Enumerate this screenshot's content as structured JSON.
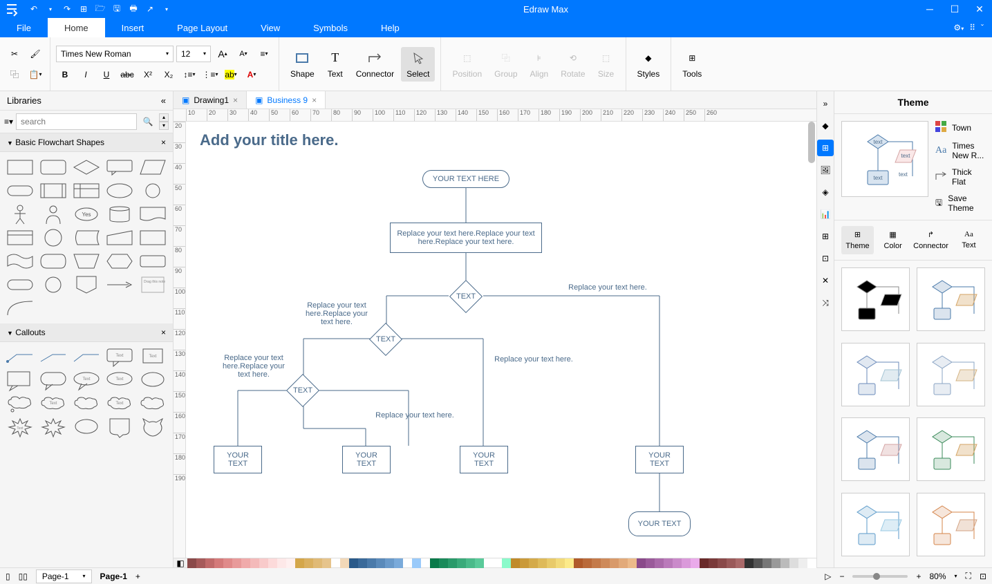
{
  "app": {
    "title": "Edraw Max"
  },
  "menu": {
    "tabs": [
      "File",
      "Home",
      "Insert",
      "Page Layout",
      "View",
      "Symbols",
      "Help"
    ],
    "active": 1
  },
  "ribbon": {
    "font_name": "Times New Roman",
    "font_size": "12",
    "big_buttons": [
      "Shape",
      "Text",
      "Connector",
      "Select"
    ],
    "big_active": 3,
    "arrange": [
      "Position",
      "Group",
      "Align",
      "Rotate",
      "Size"
    ],
    "right": [
      "Styles",
      "Tools"
    ]
  },
  "left": {
    "title": "Libraries",
    "search_placeholder": "search",
    "sections": [
      "Basic Flowchart Shapes",
      "Callouts"
    ]
  },
  "doc_tabs": [
    {
      "label": "Drawing1",
      "active": false
    },
    {
      "label": "Business 9",
      "active": true
    }
  ],
  "ruler_h": [
    "10",
    "20",
    "30",
    "40",
    "50",
    "60",
    "70",
    "80",
    "90",
    "100",
    "110",
    "120",
    "130",
    "140",
    "150",
    "160",
    "170",
    "180",
    "190",
    "200",
    "210",
    "220",
    "230",
    "240",
    "250",
    "260"
  ],
  "ruler_v": [
    "20",
    "30",
    "40",
    "50",
    "60",
    "70",
    "80",
    "90",
    "100",
    "110",
    "120",
    "130",
    "140",
    "150",
    "160",
    "170",
    "180",
    "190"
  ],
  "canvas": {
    "title": "Add your title here.",
    "start": "YOUR TEXT HERE",
    "process1": "Replace your text here.Replace your text here.Replace your text here.",
    "decision1": "TEXT",
    "decision2": "TEXT",
    "decision3": "TEXT",
    "label_right": "Replace your text here.",
    "label_left1": "Replace your text here.Replace your text here.",
    "label_left2": "Replace your text here.Replace your text here.",
    "label_mid1": "Replace your text here.",
    "label_mid2": "Replace your text here.",
    "box1": "YOUR TEXT",
    "box2": "YOUR TEXT",
    "box3": "YOUR TEXT",
    "box4": "YOUR TEXT",
    "end": "YOUR TEXT"
  },
  "theme": {
    "title": "Theme",
    "color_scheme": "Town",
    "font": "Times New R...",
    "connector": "Thick Flat",
    "save": "Save Theme",
    "tabs": [
      "Theme",
      "Color",
      "Connector",
      "Text"
    ],
    "tab_active": 0
  },
  "status": {
    "page_select": "Page-1",
    "page_label": "Page-1",
    "zoom": "80%"
  },
  "color_palette": [
    "#8b4a4a",
    "#a65a5a",
    "#c06a6a",
    "#d47a7a",
    "#e08a8a",
    "#e89a9a",
    "#f0aaaa",
    "#f4baba",
    "#f8caca",
    "#fcdada",
    "#fde8e8",
    "#fef0f0",
    "#d4a64a",
    "#dab060",
    "#e0ba76",
    "#e6c48c",
    "#ecce a2",
    "#f2d8b8",
    "#2a5a8a",
    "#3a6a9a",
    "#4a7aaa",
    "#5a8aba",
    "#6a9aca",
    "#7aaaDA",
    "#8abae a",
    "#9acafa",
    "#aad aff",
    "#0a7a4a",
    "#1a8a5a",
    "#2a9a6a",
    "#3aaa7a",
    "#4aba8a",
    "#5aca9a",
    "#6ad aaa",
    "#7ae aba",
    "#8afaca",
    "#c08a2a",
    "#ca9a3a",
    "#d4aa4a",
    "#deba5a",
    "#e8ca6a",
    "#f2da7a",
    "#fcea8a",
    "#b05a2a",
    "#ba6a3a",
    "#c47a4a",
    "#ce8a5a",
    "#d89a6a",
    "#e2aa7a",
    "#eCBa8a",
    "#8a4a8a",
    "#9a5a9a",
    "#aa6aaa",
    "#ba7aba",
    "#ca8aca",
    "#da9ada",
    "#eaaaea",
    "#6a2a2a",
    "#7a3a3a",
    "#8a4a4a",
    "#9a5a5a",
    "#aa6a6a",
    "#333",
    "#555",
    "#777",
    "#999",
    "#bbb",
    "#ddd",
    "#eee",
    "#fff"
  ]
}
